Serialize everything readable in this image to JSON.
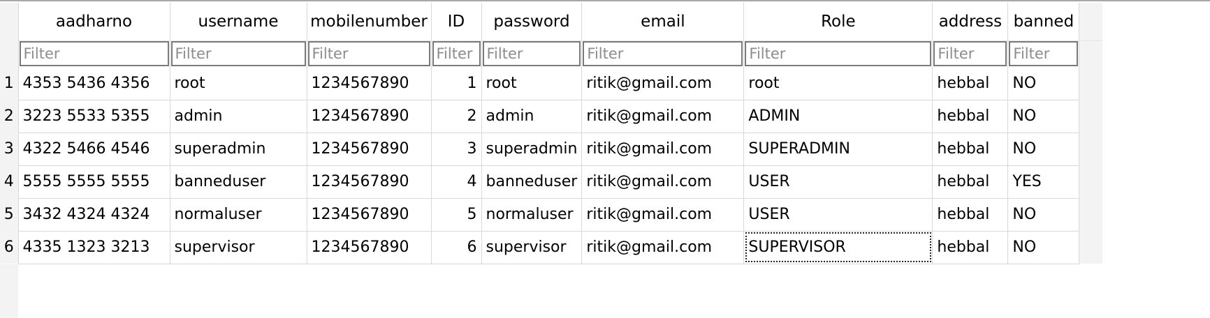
{
  "table": {
    "columns": [
      {
        "key": "aadharno",
        "label": "aadharno",
        "align": "left"
      },
      {
        "key": "username",
        "label": "username",
        "align": "left"
      },
      {
        "key": "mobilenumber",
        "label": "mobilenumber",
        "align": "left"
      },
      {
        "key": "ID",
        "label": "ID",
        "align": "right"
      },
      {
        "key": "password",
        "label": "password",
        "align": "left"
      },
      {
        "key": "email",
        "label": "email",
        "align": "left"
      },
      {
        "key": "Role",
        "label": "Role",
        "align": "left"
      },
      {
        "key": "address",
        "label": "address",
        "align": "left"
      },
      {
        "key": "banned",
        "label": "banned",
        "align": "left"
      }
    ],
    "filter_placeholder": "Filter",
    "rows": [
      {
        "num": "1",
        "cells": [
          "4353 5436 4356",
          "root",
          "1234567890",
          "1",
          "root",
          "ritik@gmail.com",
          "root",
          "hebbal",
          "NO"
        ]
      },
      {
        "num": "2",
        "cells": [
          "3223 5533 5355",
          "admin",
          "1234567890",
          "2",
          "admin",
          "ritik@gmail.com",
          "ADMIN",
          "hebbal",
          "NO"
        ]
      },
      {
        "num": "3",
        "cells": [
          "4322 5466 4546",
          "superadmin",
          "1234567890",
          "3",
          "superadmin",
          "ritik@gmail.com",
          "SUPERADMIN",
          "hebbal",
          "NO"
        ]
      },
      {
        "num": "4",
        "cells": [
          "5555 5555 5555",
          "banneduser",
          "1234567890",
          "4",
          "banneduser",
          "ritik@gmail.com",
          "USER",
          "hebbal",
          "YES"
        ]
      },
      {
        "num": "5",
        "cells": [
          "3432 4324 4324",
          "normaluser",
          "1234567890",
          "5",
          "normaluser",
          "ritik@gmail.com",
          "USER",
          "hebbal",
          "NO"
        ]
      },
      {
        "num": "6",
        "cells": [
          "4335 1323 3213",
          "supervisor",
          "1234567890",
          "6",
          "supervisor",
          "ritik@gmail.com",
          "SUPERVISOR",
          "hebbal",
          "NO"
        ]
      }
    ],
    "selected_cell": {
      "row": 6,
      "column": "Role"
    }
  },
  "colors": {
    "grid_line": "#d8d8d8",
    "filter_border": "#7a7a7a",
    "placeholder": "#8c8c8c",
    "gutter": "#f3f3f3"
  }
}
